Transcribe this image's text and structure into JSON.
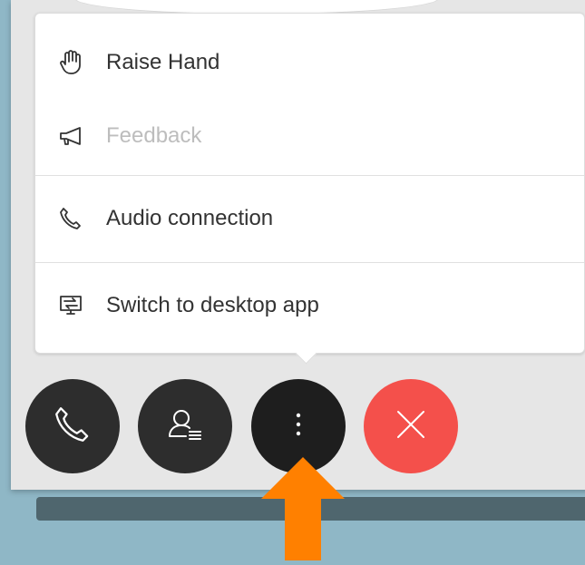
{
  "menu": {
    "items": [
      {
        "label": "Raise Hand",
        "icon": "hand-icon",
        "enabled": true
      },
      {
        "label": "Feedback",
        "icon": "megaphone-icon",
        "enabled": false
      },
      {
        "label": "Audio connection",
        "icon": "phone-icon",
        "enabled": true
      },
      {
        "label": "Switch to desktop app",
        "icon": "desktop-app-icon",
        "enabled": true
      }
    ]
  },
  "toolbar": {
    "buttons": [
      {
        "name": "audio-button",
        "icon": "phone-icon",
        "color": "#2d2d2d"
      },
      {
        "name": "participants-button",
        "icon": "participants-icon",
        "color": "#2d2d2d"
      },
      {
        "name": "more-options-button",
        "icon": "more-vertical-icon",
        "color": "#1e1e1e",
        "active": true
      },
      {
        "name": "leave-meeting-button",
        "icon": "close-icon",
        "color": "#f4504b"
      }
    ]
  },
  "annotation": {
    "icon": "up-arrow-icon",
    "color": "#ff8000"
  }
}
